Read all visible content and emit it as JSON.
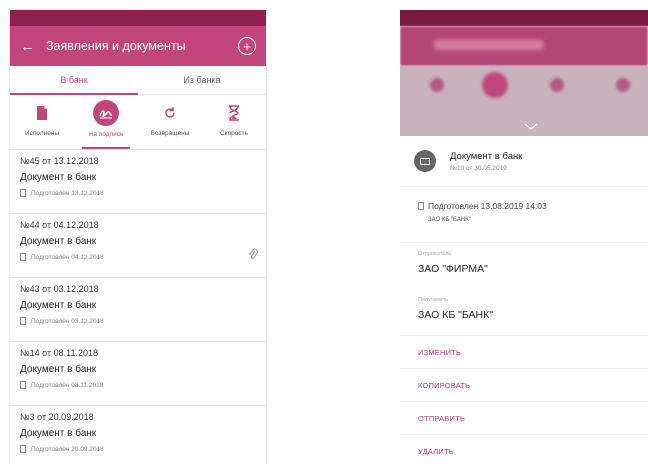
{
  "left": {
    "appbar": {
      "title": "Заявления и документы",
      "back_icon": "←",
      "add_icon": "+"
    },
    "tabs": [
      {
        "label": "В банк",
        "active": true
      },
      {
        "label": "Из банка",
        "active": false
      }
    ],
    "filters": [
      {
        "label": "Исполнены",
        "icon": "doc-icon",
        "active": false
      },
      {
        "label": "На подпись",
        "icon": "signature-icon",
        "active": true
      },
      {
        "label": "Возвращены",
        "icon": "refresh-icon",
        "active": false
      },
      {
        "label": "Скорость",
        "icon": "hourglass-icon",
        "active": false
      }
    ],
    "documents": [
      {
        "number": "№45 от 13.12.2018",
        "name": "Документ в банк",
        "status": "Подготовлен 13.12.2018",
        "attachment": false
      },
      {
        "number": "№44 от 04.12.2018",
        "name": "Документ в банк",
        "status": "Подготовлен 04.12.2018",
        "attachment": true
      },
      {
        "number": "№43 от 03.12.2018",
        "name": "Документ в банк",
        "status": "Подготовлен 03.12.2018",
        "attachment": false
      },
      {
        "number": "№14 от 08.11.2018",
        "name": "Документ в банк",
        "status": "Подготовлен 08.11.2018",
        "attachment": false
      },
      {
        "number": "№3 от 20.09.2018",
        "name": "Документ в банк",
        "status": "Подготовлен 20.09.2018",
        "attachment": false
      }
    ]
  },
  "right": {
    "sheet": {
      "title": "Документ в банк",
      "subtitle": "№10 от 30.05.2019",
      "status": "Подготовлен 13.08.2019 14:03",
      "status_org": "ЗАО КБ \"БАНК\"",
      "sender_label": "Отправитель",
      "sender_value": "ЗАО \"ФИРМА\"",
      "receiver_label": "Получатель",
      "receiver_value": "ЗАО КБ \"БАНК\"",
      "actions": [
        "ИЗМЕНИТЬ",
        "КОПИРОВАТЬ",
        "ОТПРАВИТЬ",
        "УДАЛИТЬ"
      ]
    }
  },
  "colors": {
    "accent": "#c2467b",
    "status_bar": "#8f1f4c"
  }
}
